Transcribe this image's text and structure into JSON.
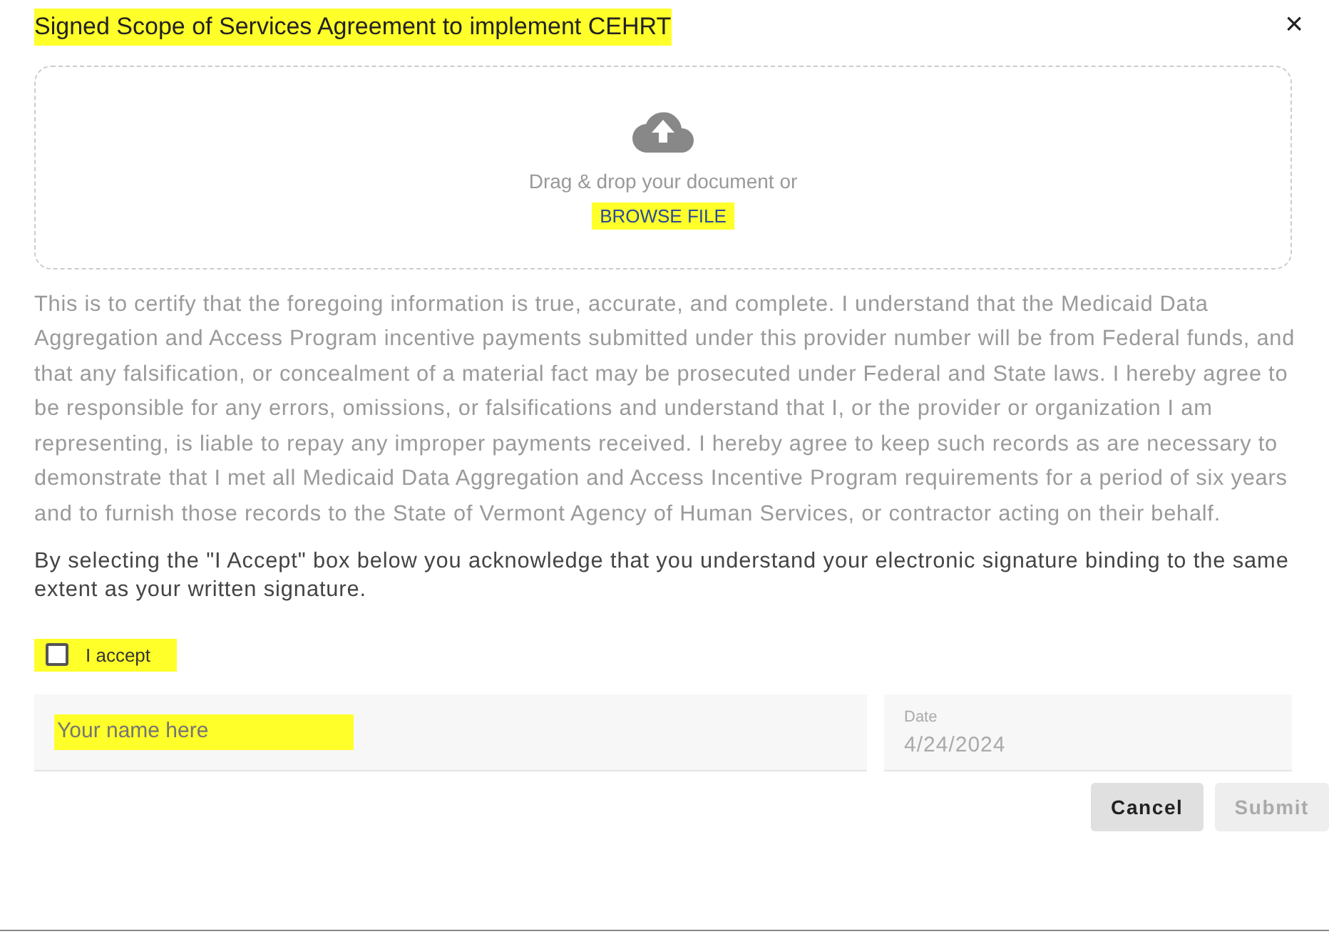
{
  "dialog": {
    "title": "Signed Scope of Services Agreement to implement CEHRT",
    "title_highlighted": true,
    "close": "×"
  },
  "upload": {
    "prompt": "Drag & drop your document or",
    "browse": "BROWSE FILE",
    "browse_highlighted": true
  },
  "certification": "This is to certify that the foregoing information is true, accurate, and complete. I understand that the Medicaid Data Aggregation and Access Program incentive payments submitted under this provider number will be from Federal funds, and that any falsification, or concealment of a material fact may be prosecuted under Federal and State laws. I hereby agree to be responsible for any errors, omissions, or falsifications and understand that I, or the provider or organization I am representing, is liable to repay any improper payments received. I hereby agree to keep such records as are necessary to demonstrate that I met all Medicaid Data Aggregation and Access Incentive Program requirements for a period of six years and to furnish those records to the State of Vermont Agency of Human Services, or contractor acting on their behalf.",
  "acknowledgement": "By selecting the \"I Accept\" box below you acknowledge that you understand your electronic signature binding to the same extent as your written signature.",
  "accept": {
    "label": "I accept",
    "checked": false,
    "highlighted": true
  },
  "name_field": {
    "placeholder": "Your name here",
    "highlighted": true
  },
  "date_field": {
    "label": "Date",
    "value": "4/24/2024"
  },
  "buttons": [
    {
      "label": "Cancel",
      "disabled": false
    },
    {
      "label": "Submit",
      "disabled": true
    }
  ]
}
